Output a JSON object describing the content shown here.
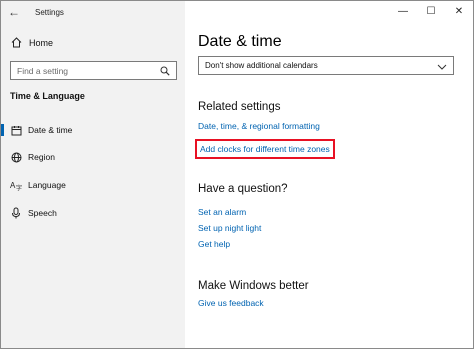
{
  "app": {
    "title": "Settings"
  },
  "window_controls": {
    "minimize": "—",
    "maximize": "☐",
    "close": "✕"
  },
  "sidebar": {
    "home_label": "Home",
    "search_placeholder": "Find a setting",
    "section_title": "Time & Language",
    "items": [
      {
        "label": "Date & time",
        "icon": "calendar-icon",
        "selected": true
      },
      {
        "label": "Region",
        "icon": "globe-icon",
        "selected": false
      },
      {
        "label": "Language",
        "icon": "language-icon",
        "selected": false
      },
      {
        "label": "Speech",
        "icon": "microphone-icon",
        "selected": false
      }
    ]
  },
  "main": {
    "title": "Date & time",
    "calendar_dropdown": {
      "value": "Don't show additional calendars"
    },
    "related": {
      "heading": "Related settings",
      "links": [
        "Date, time, & regional formatting",
        "Add clocks for different time zones"
      ]
    },
    "question": {
      "heading": "Have a question?",
      "links": [
        "Set an alarm",
        "Set up night light",
        "Get help"
      ]
    },
    "better": {
      "heading": "Make Windows better",
      "links": [
        "Give us feedback"
      ]
    }
  },
  "colors": {
    "accent": "#0063b1",
    "highlight": "#e81123",
    "sidebar_bg": "#f2f2f2"
  }
}
